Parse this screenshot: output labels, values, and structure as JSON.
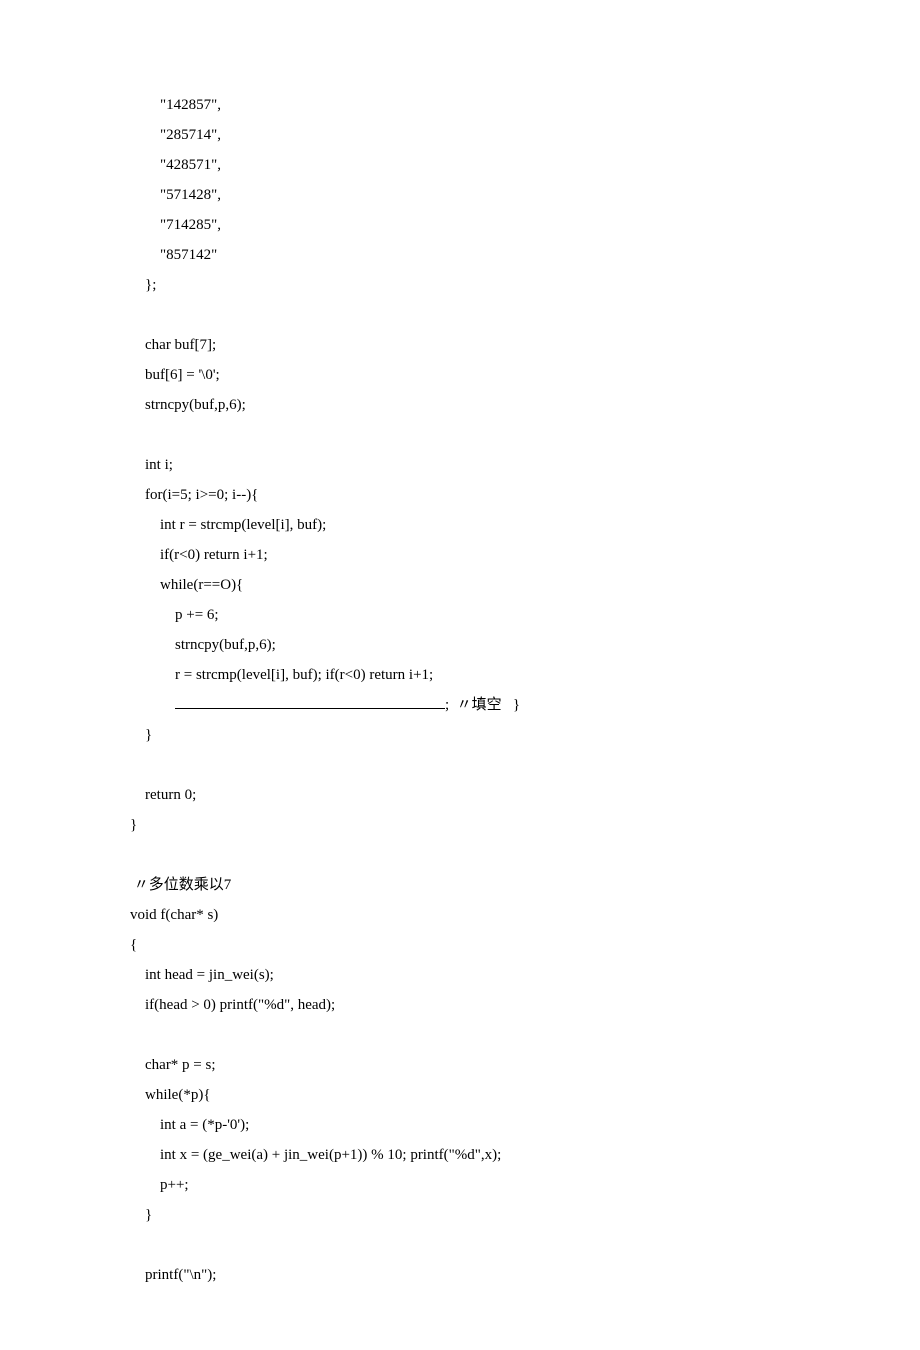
{
  "code": {
    "l1": "        \"142857\",",
    "l2": "        \"285714\",",
    "l3": "        \"428571\",",
    "l4": "        \"571428\",",
    "l5": "        \"714285\",",
    "l6": "        \"857142\"",
    "l7": "    };",
    "l8": "",
    "l9": "    char buf[7];",
    "l10": "    buf[6] = '\\0';",
    "l11": "    strncpy(buf,p,6);",
    "l12": "",
    "l13": "    int i;",
    "l14": "    for(i=5; i>=0; i--){",
    "l15": "        int r = strcmp(level[i], buf);",
    "l16": "        if(r<0) return i+1;",
    "l17": "        while(r==O){",
    "l18": "            p += 6;",
    "l19": "            strncpy(buf,p,6);",
    "l20": "            r = strcmp(level[i], buf); if(r<0) return i+1;",
    "l21a": "            ",
    "l21b": ";  〃填空   }",
    "l22": "    }",
    "l23": "",
    "l24": "    return 0;",
    "l25": "}",
    "l26": "",
    "l27": " 〃多位数乘以7",
    "l28": "void f(char* s)",
    "l29": "{",
    "l30": "    int head = jin_wei(s);",
    "l31": "    if(head > 0) printf(\"%d\", head);",
    "l32": "",
    "l33": "    char* p = s;",
    "l34": "    while(*p){",
    "l35": "        int a = (*p-'0');",
    "l36": "        int x = (ge_wei(a) + jin_wei(p+1)) % 10; printf(\"%d\",x);",
    "l37": "        p++;",
    "l38": "    }",
    "l39": "",
    "l40": "    printf(\"\\n\");"
  }
}
